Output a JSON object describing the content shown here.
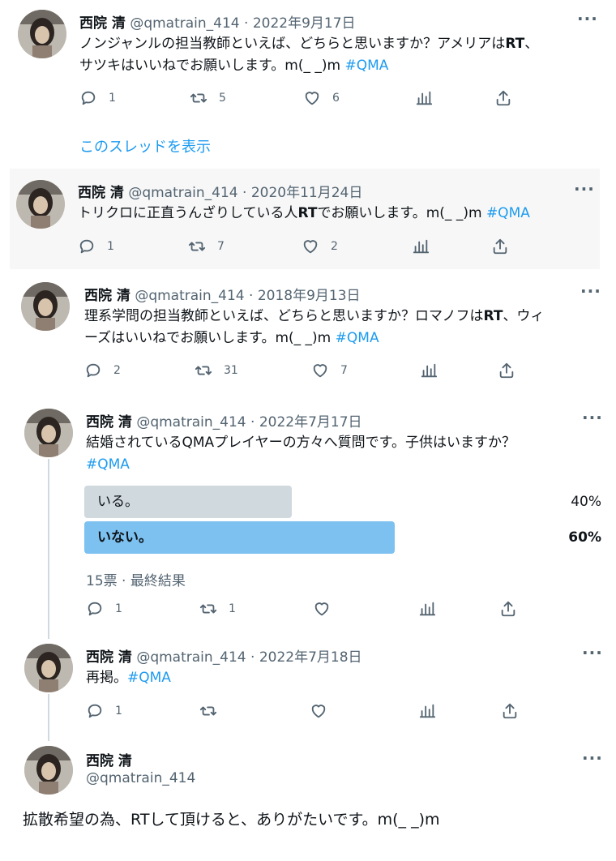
{
  "tweets": [
    {
      "name": "西院 清",
      "meta": "@qmatrain_414 · 2022年9月17日",
      "line1": "ノンジャンルの担当教師といえば、どちらと思いますか？アメリアは",
      "line1_bold": "RT",
      "line1_end": "、",
      "line2": "サツキはいいねでお願いします。m(_ _)m ",
      "hashtag": "#QMA",
      "reply": "1",
      "retweet": "5",
      "like": "6",
      "thread_link": "このスレッドを表示"
    },
    {
      "name": "西院 清",
      "meta": "@qmatrain_414 · 2020年11月24日",
      "line1": "トリクロに正直うんざりしている人",
      "line1_bold": "RT",
      "line1_end": "でお願いします。m(_ _)m ",
      "hashtag": "#QMA",
      "reply": "1",
      "retweet": "7",
      "like": "2"
    },
    {
      "name": "西院 清",
      "meta": "@qmatrain_414 · 2018年9月13日",
      "line1": "理系学問の担当教師といえば、どちらと思いますか？ロマノフは",
      "line1_bold": "RT",
      "line1_end": "、ウィ",
      "line2": "ーズはいいねでお願いします。m(_ _)m ",
      "hashtag": "#QMA",
      "reply": "2",
      "retweet": "31",
      "like": "7"
    },
    {
      "name": "西院 清",
      "meta": "@qmatrain_414 · 2022年7月17日",
      "line1": "結婚されているQMAプレイヤーの方々へ質問です。子供はいますか？",
      "hashtag": "#QMA",
      "poll": {
        "options": [
          {
            "label": "いる。",
            "pct": "40%",
            "value": 40
          },
          {
            "label": "いない。",
            "pct": "60%",
            "value": 60
          }
        ],
        "meta": "15票 · 最終結果"
      },
      "reply": "1",
      "retweet": "1"
    },
    {
      "name": "西院 清",
      "meta": "@qmatrain_414 · 2022年7月18日",
      "line1": "再掲。",
      "hashtag": "#QMA",
      "reply": "1"
    },
    {
      "name": "西院 清",
      "handle": "@qmatrain_414",
      "text": "拡散希望の為、RTして頂けると、ありがたいです。m(_ _)m"
    }
  ],
  "more_label": "···"
}
